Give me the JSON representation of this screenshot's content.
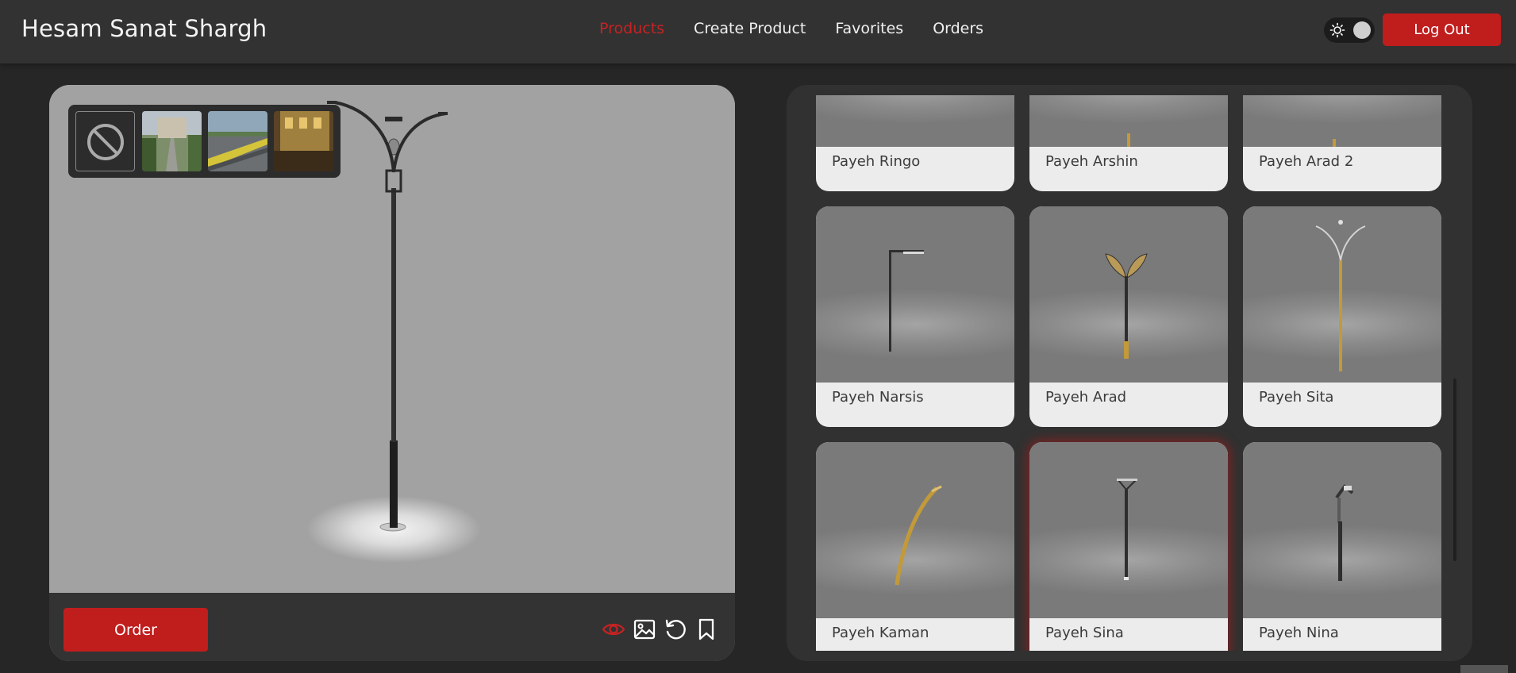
{
  "header": {
    "brand": "Hesam Sanat Shargh",
    "nav": [
      {
        "label": "Products",
        "active": true
      },
      {
        "label": "Create Product",
        "active": false
      },
      {
        "label": "Favorites",
        "active": false
      },
      {
        "label": "Orders",
        "active": false
      }
    ],
    "logout_label": "Log Out",
    "theme_icon": "sun-icon"
  },
  "viewer": {
    "environments": [
      "none-icon",
      "courtyard",
      "highway",
      "night-street"
    ],
    "order_label": "Order",
    "tools": [
      "eye-icon",
      "image-icon",
      "reset-icon",
      "bookmark-icon"
    ]
  },
  "products": [
    {
      "name": "Payeh Ringo"
    },
    {
      "name": "Payeh Arshin"
    },
    {
      "name": "Payeh Arad 2"
    },
    {
      "name": "Payeh Narsis"
    },
    {
      "name": "Payeh Arad"
    },
    {
      "name": "Payeh Sita"
    },
    {
      "name": "Payeh Kaman"
    },
    {
      "name": "Payeh Sina",
      "selected": true
    },
    {
      "name": "Payeh Nina"
    }
  ],
  "colors": {
    "accent": "#c01d1d",
    "header_bg": "#323232",
    "page_bg": "#262626"
  }
}
